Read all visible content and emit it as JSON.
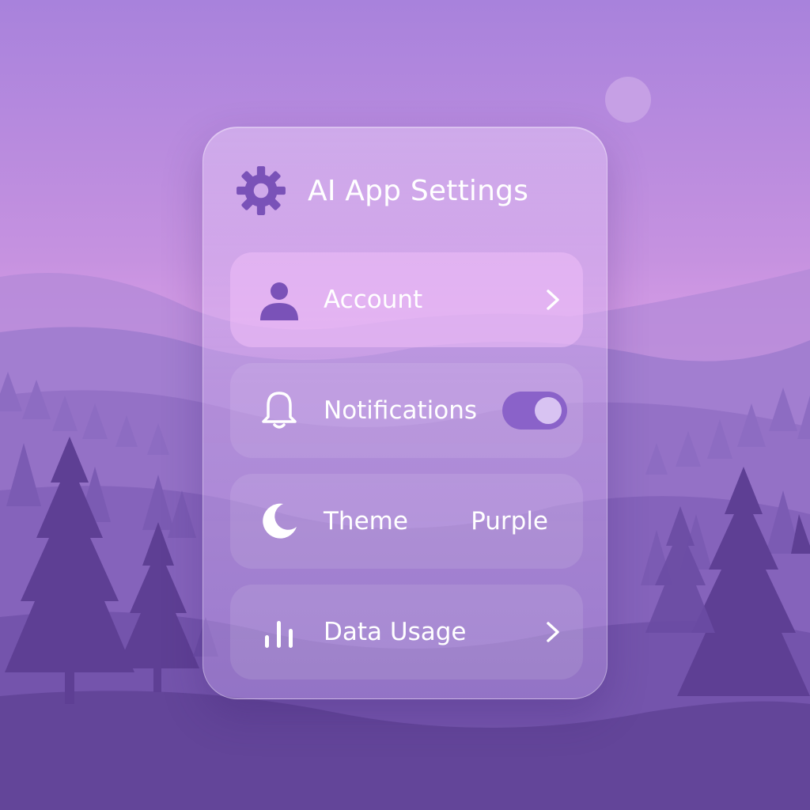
{
  "panel": {
    "title": "AI App Settings",
    "title_icon": "gear-icon"
  },
  "rows": [
    {
      "label": "Account",
      "icon": "user-icon",
      "trailing": "chevron-right-icon",
      "highlighted": true
    },
    {
      "label": "Notifications",
      "icon": "bell-icon",
      "trailing": "toggle",
      "toggle_on": true
    },
    {
      "label": "Theme",
      "icon": "moon-icon",
      "value": "Purple"
    },
    {
      "label": "Data Usage",
      "icon": "bar-chart-icon",
      "trailing": "chevron-right-icon"
    }
  ],
  "colors": {
    "sky_top": "#a882dc",
    "sky_horizon": "#d69ae6",
    "accent": "#7a52b8",
    "toggle_track": "#8a62c9",
    "toggle_knob": "#d8c3f2"
  }
}
